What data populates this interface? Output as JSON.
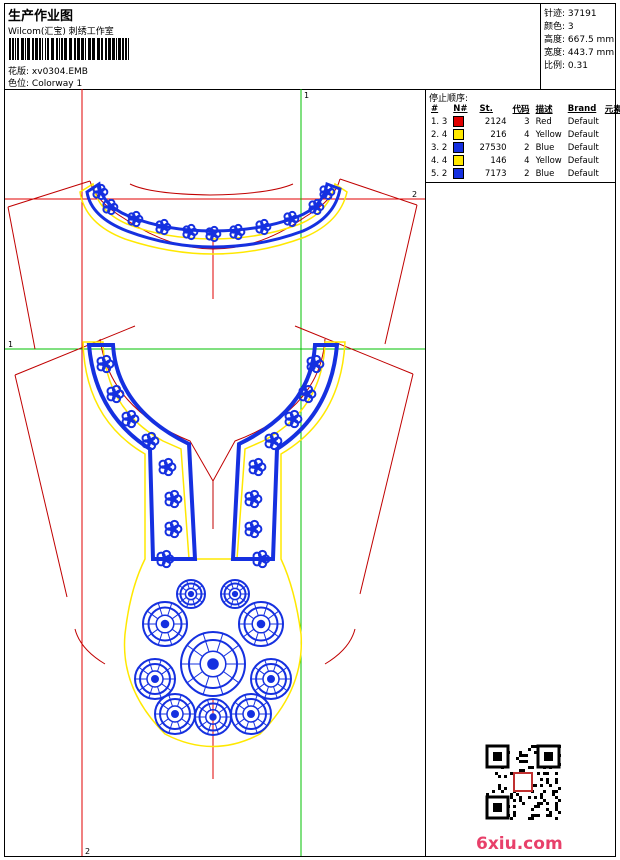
{
  "header": {
    "title": "生产作业图",
    "subtitle": "Wilcom(汇宝) 刺绣工作室",
    "file_label": "花版:",
    "file_value": "xv0304.EMB",
    "colorway_label": "色位:",
    "colorway_value": "Colorway 1"
  },
  "stats": [
    {
      "label": "针迹:",
      "value": "37191"
    },
    {
      "label": "颜色:",
      "value": "3"
    },
    {
      "label": "高度:",
      "value": "667.5 mm"
    },
    {
      "label": "宽度:",
      "value": "443.7 mm"
    },
    {
      "label": "比例:",
      "value": "0.31"
    }
  ],
  "stop_sequence": {
    "title": "停止顺序:",
    "headers": [
      "#",
      "N#",
      "St.",
      "代码",
      "描述",
      "Brand",
      "元素"
    ],
    "rows": [
      {
        "num": "1.",
        "n": "3",
        "color": "#e00000",
        "st": "2124",
        "code": "3",
        "desc": "Red",
        "brand": "Default"
      },
      {
        "num": "2.",
        "n": "4",
        "color": "#ffe800",
        "st": "216",
        "code": "4",
        "desc": "Yellow",
        "brand": "Default"
      },
      {
        "num": "3.",
        "n": "2",
        "color": "#1530e0",
        "st": "27530",
        "code": "2",
        "desc": "Blue",
        "brand": "Default"
      },
      {
        "num": "4.",
        "n": "4",
        "color": "#ffe800",
        "st": "146",
        "code": "4",
        "desc": "Yellow",
        "brand": "Default"
      },
      {
        "num": "5.",
        "n": "2",
        "color": "#1530e0",
        "st": "7173",
        "code": "2",
        "desc": "Blue",
        "brand": "Default"
      }
    ]
  },
  "guides": {
    "v1": "1",
    "h1": "1",
    "v2": "2",
    "h2": "2"
  },
  "colors": {
    "outline": "#c00000",
    "guide_red": "#e00000",
    "guide_green": "#00c000",
    "stitch": "#1530e0",
    "border": "#ffe800"
  },
  "watermark": {
    "site": "6xiu.com"
  }
}
